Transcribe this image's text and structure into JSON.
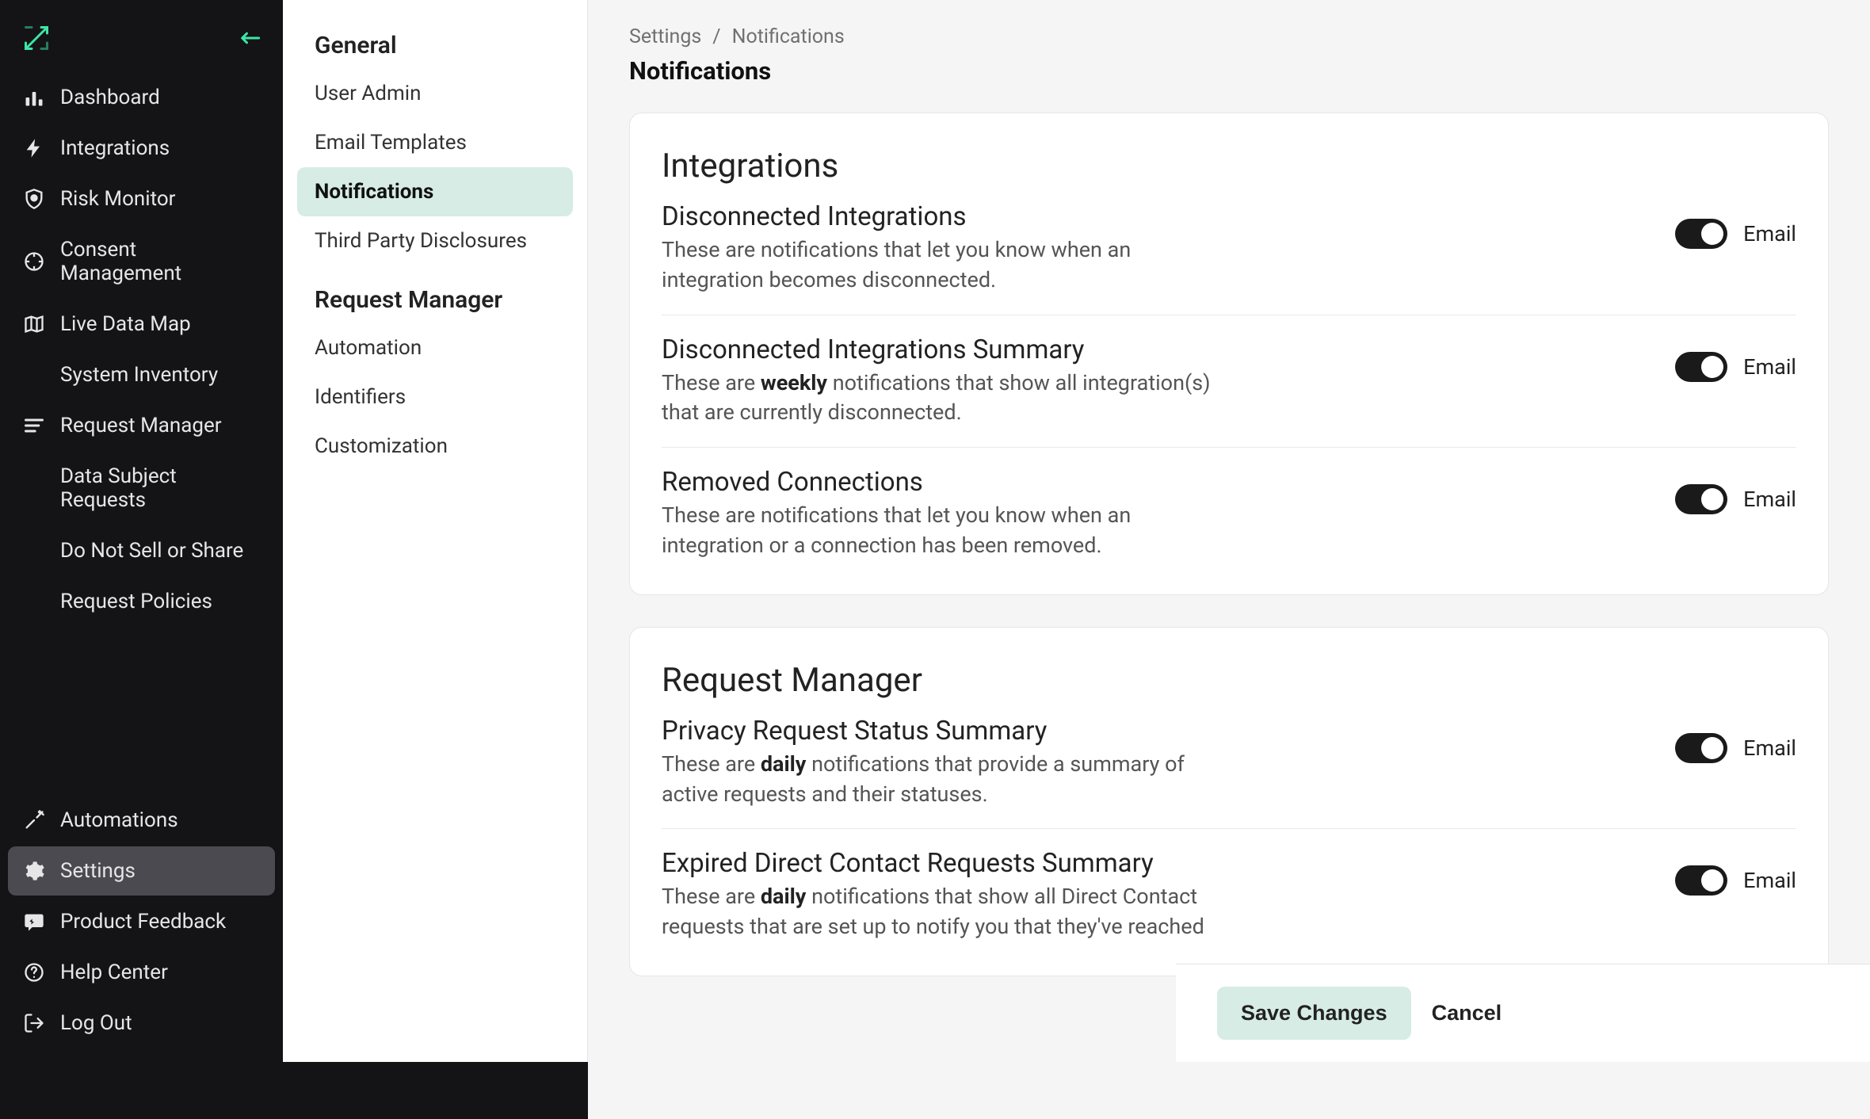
{
  "sidebar": {
    "nav": [
      {
        "label": "Dashboard"
      },
      {
        "label": "Integrations"
      },
      {
        "label": "Risk Monitor"
      },
      {
        "label": "Consent Management"
      },
      {
        "label": "Live Data Map"
      },
      {
        "label": "System Inventory",
        "sub": true
      },
      {
        "label": "Request Manager"
      },
      {
        "label": "Data Subject Requests",
        "sub": true
      },
      {
        "label": "Do Not Sell or Share",
        "sub": true
      },
      {
        "label": "Request Policies",
        "sub": true
      }
    ],
    "bottom": [
      {
        "label": "Automations"
      },
      {
        "label": "Settings",
        "active": true
      },
      {
        "label": "Product Feedback"
      },
      {
        "label": "Help Center"
      },
      {
        "label": "Log Out"
      }
    ]
  },
  "settings": {
    "sections": [
      {
        "title": "General",
        "items": [
          {
            "label": "User Admin"
          },
          {
            "label": "Email Templates"
          },
          {
            "label": "Notifications",
            "active": true
          },
          {
            "label": "Third Party Disclosures"
          }
        ]
      },
      {
        "title": "Request Manager",
        "items": [
          {
            "label": "Automation"
          },
          {
            "label": "Identifiers"
          },
          {
            "label": "Customization"
          }
        ]
      }
    ]
  },
  "breadcrumb": {
    "root": "Settings",
    "sep": "/",
    "current": "Notifications"
  },
  "page_title": "Notifications",
  "cards": [
    {
      "title": "Integrations",
      "rows": [
        {
          "title": "Disconnected Integrations",
          "desc_prefix": "These are notifications that let you know when an integration becomes disconnected.",
          "toggle_label": "Email"
        },
        {
          "title": "Disconnected Integrations Summary",
          "desc_prefix": "These are ",
          "desc_bold": "weekly",
          "desc_suffix": " notifications that show all integration(s) that are currently disconnected.",
          "toggle_label": "Email"
        },
        {
          "title": "Removed Connections",
          "desc_prefix": "These are notifications that let you know when an integration or a connection has been removed.",
          "toggle_label": "Email"
        }
      ]
    },
    {
      "title": "Request Manager",
      "rows": [
        {
          "title": "Privacy Request Status Summary",
          "desc_prefix": "These are ",
          "desc_bold": "daily",
          "desc_suffix": " notifications that provide a summary of active requests and their statuses.",
          "toggle_label": "Email"
        },
        {
          "title": "Expired Direct Contact Requests Summary",
          "desc_prefix": "These are ",
          "desc_bold": "daily",
          "desc_suffix": " notifications that show all Direct Contact requests that are set up to notify you that they've reached",
          "toggle_label": "Email"
        }
      ]
    }
  ],
  "footer": {
    "save": "Save Changes",
    "cancel": "Cancel"
  }
}
